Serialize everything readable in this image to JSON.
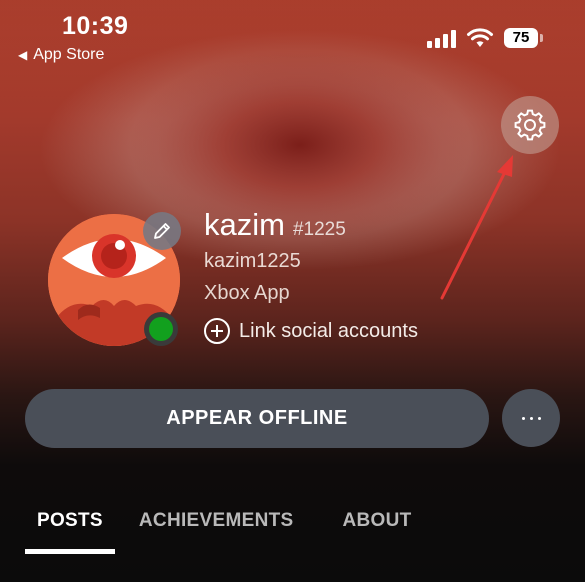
{
  "status_bar": {
    "time": "10:39",
    "back_label": "App Store",
    "battery": "75"
  },
  "profile": {
    "gamertag": "kazim",
    "suffix": "#1225",
    "real_name": "kazim1225",
    "app_name": "Xbox App",
    "link_social": "Link social accounts",
    "presence_color": "#12a01e"
  },
  "actions": {
    "appear_offline": "APPEAR OFFLINE"
  },
  "tabs": [
    {
      "label": "POSTS",
      "active": true
    },
    {
      "label": "ACHIEVEMENTS",
      "active": false
    },
    {
      "label": "ABOUT",
      "active": false
    }
  ],
  "icons": [
    "back-arrow-icon",
    "signal-icon",
    "wifi-icon",
    "battery-icon",
    "gear-icon",
    "pencil-icon",
    "plus-circle-icon",
    "more-dots-icon"
  ],
  "colors": {
    "annotation_arrow": "#e53935",
    "button_bg": "#4a4f58",
    "online": "#12a01e"
  }
}
